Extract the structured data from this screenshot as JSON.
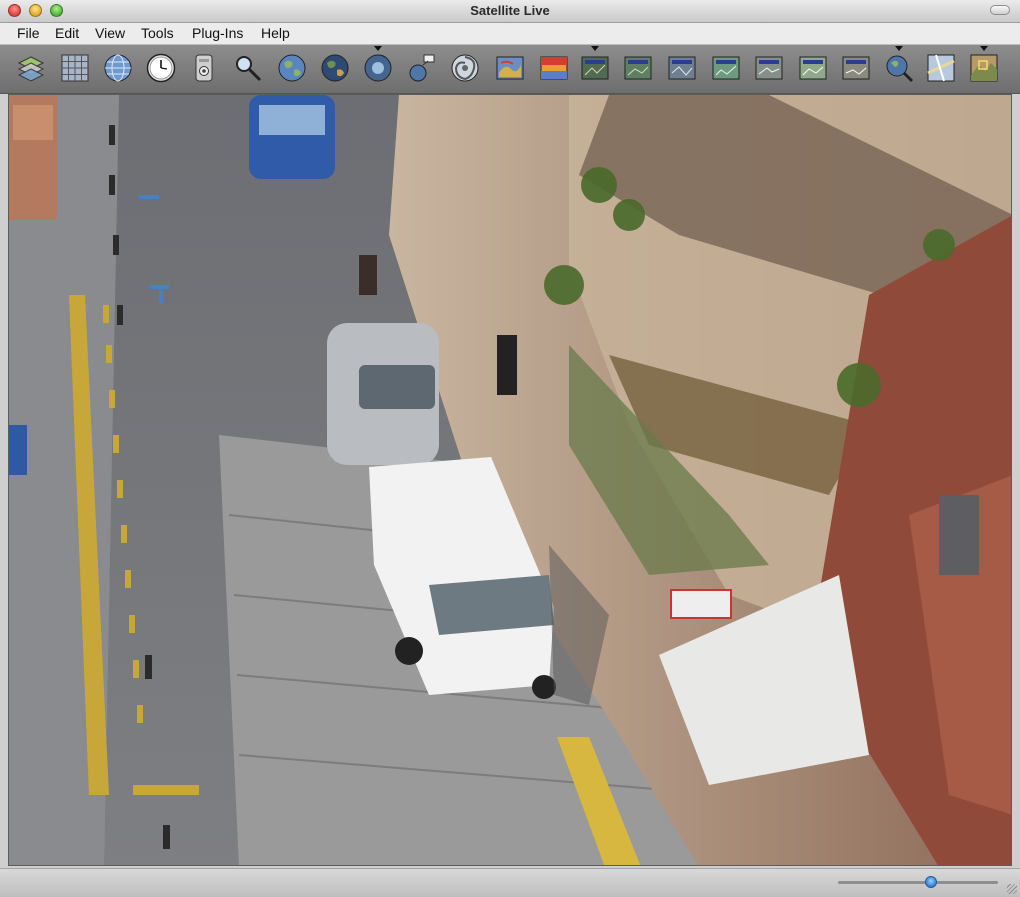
{
  "window": {
    "title": "Satellite Live"
  },
  "menu": {
    "file": "File",
    "edit": "Edit",
    "view": "View",
    "tools": "Tools",
    "plugins": "Plug-Ins",
    "help": "Help"
  },
  "toolbar": {
    "icons": [
      "layers-icon",
      "grid-icon",
      "globe-icon",
      "clock-icon",
      "webcam-icon",
      "magnifier-icon",
      "earth-icon",
      "earth-night-icon",
      "earth-dropdown-icon",
      "satellite-icon",
      "hurricane-icon",
      "weather-map-icon",
      "temperature-map-icon",
      "map-overlay-icon",
      "map-1-icon",
      "map-2-icon",
      "map-3-icon",
      "map-4-icon",
      "map-5-icon",
      "map-6-icon",
      "globe-search-icon",
      "road-map-icon",
      "terrain-map-icon"
    ]
  },
  "viewport": {
    "content": "street-aerial-view"
  },
  "zoom": {
    "level_fraction": 0.58
  },
  "colors": {
    "toolbar_bg": "#7d7d7d",
    "menubar_bg": "#ececec",
    "accent": "#2c7fd8"
  }
}
